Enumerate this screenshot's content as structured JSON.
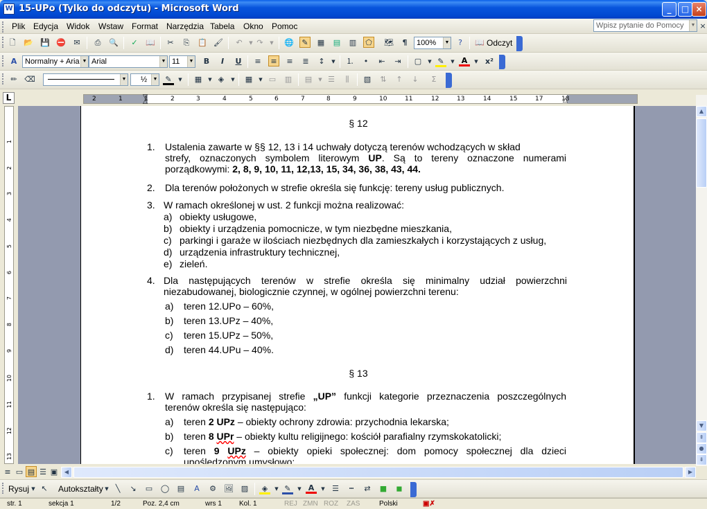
{
  "window": {
    "title": "15-UPo (Tylko do odczytu) - Microsoft Word",
    "icon": "word-icon",
    "minimize": "_",
    "maximize": "□",
    "close": "×"
  },
  "menu": {
    "items": [
      "Plik",
      "Edycja",
      "Widok",
      "Wstaw",
      "Format",
      "Narzędzia",
      "Tabela",
      "Okno",
      "Pomoc"
    ],
    "help_placeholder": "Wpisz pytanie do Pomocy"
  },
  "standard_toolbar": {
    "zoom": "100%",
    "read_label": "Odczyt"
  },
  "formatting_toolbar": {
    "style": "Normalny + Aria",
    "font": "Arial",
    "size": "11"
  },
  "drawing_top_toolbar": {
    "line_weight": "½"
  },
  "ruler": {
    "h_numbers": [
      "2",
      "1",
      "1",
      "2",
      "3",
      "4",
      "5",
      "6",
      "7",
      "8",
      "9",
      "10",
      "11",
      "12",
      "13",
      "14",
      "15",
      "17",
      "18"
    ],
    "v_numbers": [
      "1",
      "2",
      "3",
      "4",
      "5",
      "6",
      "7",
      "8",
      "9",
      "10",
      "11",
      "12",
      "13"
    ]
  },
  "document": {
    "s12_heading": "§ 12",
    "p1_num": "1.",
    "p1_l1": "Ustalenia zawarte w §§ 12, 13 i 14 uchwały dotyczą terenów wchodzących w skład",
    "p1_l2a": "strefy, oznaczonych symbolem literowym ",
    "p1_l2b": "UP",
    "p1_l2c": ". Są to tereny oznaczone numerami",
    "p1_l3a": "porządkowymi: ",
    "p1_l3b": "2, 8, 9, 10, 11, 12,13, 15, 34, 36, 38, 43, 44.",
    "p2_num": "2.",
    "p2_text": "Dla terenów położonych w strefie określa się funkcję: tereny usług publicznych.",
    "p3_num": "3.",
    "p3_text": "W ramach określonej w ust. 2 funkcji można realizować:",
    "p3_items": [
      {
        "l": "a)",
        "t": "obiekty usługowe,"
      },
      {
        "l": "b)",
        "t": "obiekty i urządzenia pomocnicze, w tym niezbędne mieszkania,"
      },
      {
        "l": "c)",
        "t": "parkingi i garaże w ilościach niezbędnych dla zamieszkałych i korzystających z usług,"
      },
      {
        "l": "d)",
        "t": "urządzenia infrastruktury technicznej,"
      },
      {
        "l": "e)",
        "t": "zieleń."
      }
    ],
    "p4_num": "4.",
    "p4_l1": "Dla następujących terenów w strefie określa się minimalny udział powierzchni",
    "p4_l2": "niezabudowanej, biologicznie czynnej, w ogólnej powierzchni terenu:",
    "p4_items": [
      {
        "l": "a)",
        "t": "teren 12.UPo – 60%,"
      },
      {
        "l": "b)",
        "t": "teren 13.UPz – 40%,"
      },
      {
        "l": "c)",
        "t": "teren 15.UPz – 50%,"
      },
      {
        "l": "d)",
        "t": "teren 44.UPu – 40%."
      }
    ],
    "s13_heading": "§ 13",
    "q1_num": "1.",
    "q1_l1a": "W ramach przypisanej strefie ",
    "q1_l1b": "„UP”",
    "q1_l1c": " funkcji kategorie przeznaczenia poszczególnych",
    "q1_l2": "terenów określa się następująco:",
    "qa_l": "a)",
    "qa_1": "teren ",
    "qa_2": "2 UPz",
    "qa_3": " – obiekty  ochrony zdrowia: przychodnia lekarska;",
    "qb_l": "b)",
    "qb_1": "teren ",
    "qb_2": "8 ",
    "qb_3": "UPr",
    "qb_4": " – obiekty kultu religijnego: kościół parafialny rzymskokatolicki;",
    "qc_l": "c)",
    "qc_1": "teren ",
    "qc_2": "9 ",
    "qc_3": "UPz",
    "qc_4": " – obiekty opieki społecznej: dom pomocy społecznej dla dzieci",
    "qc_l2": "upośledzonym umysłowo;"
  },
  "drawing_toolbar": {
    "draw_label": "Rysuj",
    "autoshapes_label": "Autokształty"
  },
  "status": {
    "page": "str. 1",
    "section": "sekcja 1",
    "pages": "1/2",
    "pos": "Poz. 2,4 cm",
    "line": "wrs 1",
    "col": "Kol. 1",
    "rej": "REJ",
    "zmn": "ZMN",
    "roz": "ROZ",
    "zas": "ZAS",
    "lang": "Polski"
  }
}
